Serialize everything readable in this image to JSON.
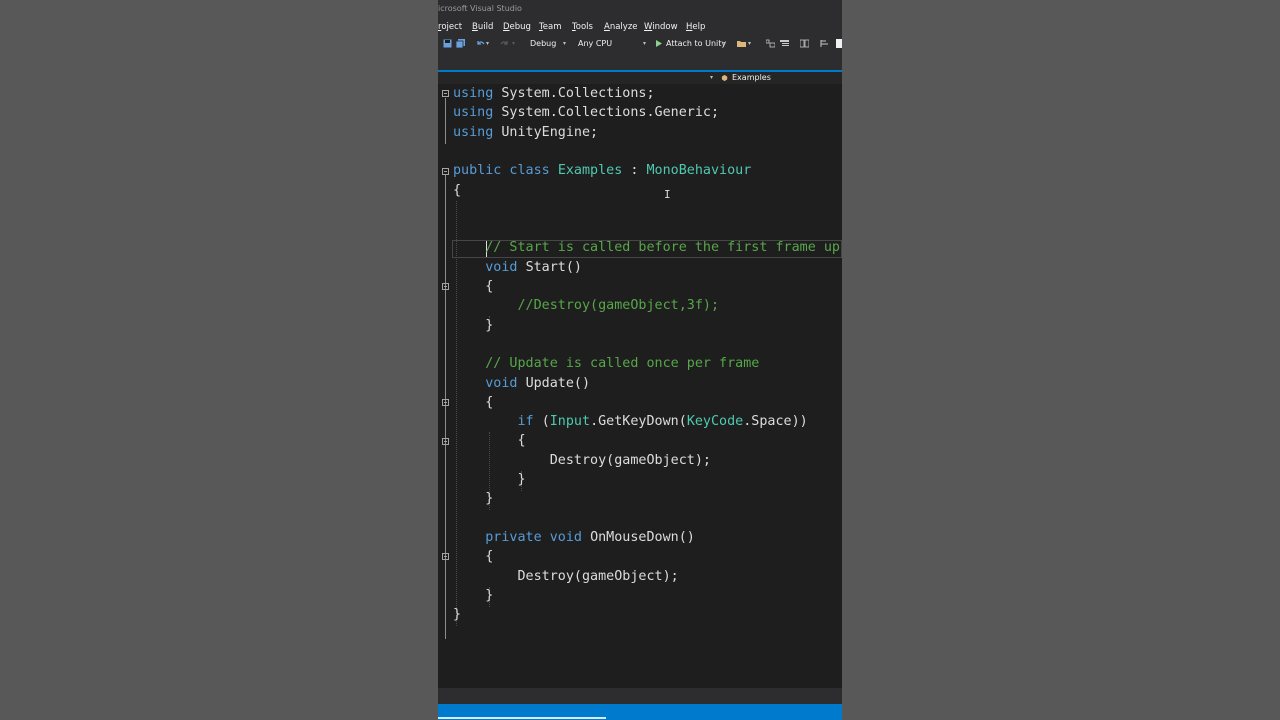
{
  "window": {
    "title": "icrosoft Visual Studio"
  },
  "menu": [
    "roject",
    "Build",
    "Debug",
    "Team",
    "Tools",
    "Analyze",
    "Window",
    "Help"
  ],
  "toolbar": {
    "configuration": "Debug",
    "platform": "Any CPU",
    "attach_label": "Attach to Unity"
  },
  "navbar": {
    "class_name": "Examples"
  },
  "code": {
    "lines": [
      [
        [
          "kw",
          "using"
        ],
        [
          "pl",
          " System"
        ],
        [
          "pl",
          "."
        ],
        [
          "pl",
          "Collections;"
        ]
      ],
      [
        [
          "kw",
          "using"
        ],
        [
          "pl",
          " System.Collections.Generic;"
        ]
      ],
      [
        [
          "kw",
          "using"
        ],
        [
          "pl",
          " UnityEngine;"
        ]
      ],
      [],
      [
        [
          "kw",
          "public class "
        ],
        [
          "ty",
          "Examples"
        ],
        [
          "pl",
          " : "
        ],
        [
          "ty",
          "MonoBehaviour"
        ]
      ],
      [
        [
          "pl",
          "{"
        ]
      ],
      [],
      [],
      [
        [
          "cm",
          "    // Start is called before the first frame up"
        ]
      ],
      [
        [
          "kw",
          "    void "
        ],
        [
          "pl",
          "Start()"
        ]
      ],
      [
        [
          "pl",
          "    {"
        ]
      ],
      [
        [
          "cm",
          "        //Destroy(gameObject,3f);"
        ]
      ],
      [
        [
          "pl",
          "    }"
        ]
      ],
      [],
      [
        [
          "cm",
          "    // Update is called once per frame"
        ]
      ],
      [
        [
          "kw",
          "    void "
        ],
        [
          "pl",
          "Update()"
        ]
      ],
      [
        [
          "pl",
          "    {"
        ]
      ],
      [
        [
          "kw",
          "        if "
        ],
        [
          "pl",
          "("
        ],
        [
          "ty",
          "Input"
        ],
        [
          "pl",
          ".GetKeyDown("
        ],
        [
          "ty",
          "KeyCode"
        ],
        [
          "pl",
          ".Space))"
        ]
      ],
      [
        [
          "pl",
          "        {"
        ]
      ],
      [
        [
          "pl",
          "            Destroy(gameObject);"
        ]
      ],
      [
        [
          "pl",
          "        }"
        ]
      ],
      [
        [
          "pl",
          "    }"
        ]
      ],
      [],
      [
        [
          "kw",
          "    private void "
        ],
        [
          "pl",
          "OnMouseDown()"
        ]
      ],
      [
        [
          "pl",
          "    {"
        ]
      ],
      [
        [
          "pl",
          "        Destroy(gameObject);"
        ]
      ],
      [
        [
          "pl",
          "    }"
        ]
      ],
      [
        [
          "pl",
          "}"
        ]
      ]
    ]
  },
  "colors": {
    "keyword": "#569cd6",
    "type": "#4ec9b0",
    "comment": "#57a64a",
    "text": "#dcdcdc",
    "accent": "#007acc",
    "editor_bg": "#1e1e1e",
    "chrome_bg": "#2d2d30"
  },
  "icons": [
    "save-icon",
    "save-all-icon",
    "undo-icon",
    "redo-icon",
    "play-icon",
    "folder-icon",
    "toolbar-misc-icon",
    "class-icon"
  ]
}
